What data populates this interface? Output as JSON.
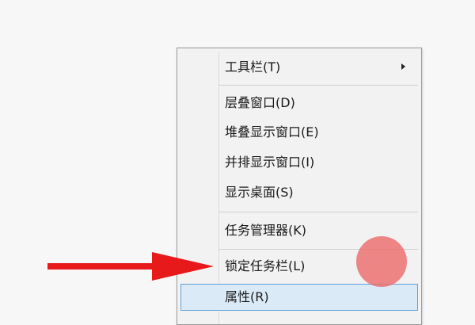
{
  "context_menu": {
    "items": [
      {
        "label": "工具栏(T)",
        "has_submenu": true
      },
      {
        "label": "层叠窗口(D)"
      },
      {
        "label": "堆叠显示窗口(E)"
      },
      {
        "label": "并排显示窗口(I)"
      },
      {
        "label": "显示桌面(S)"
      },
      {
        "label": "任务管理器(K)"
      },
      {
        "label": "锁定任务栏(L)"
      },
      {
        "label": "属性(R)",
        "highlighted": true
      }
    ]
  },
  "annotation": {
    "arrow_color": "#e8191b",
    "touch_dot_color": "#ec6666"
  }
}
